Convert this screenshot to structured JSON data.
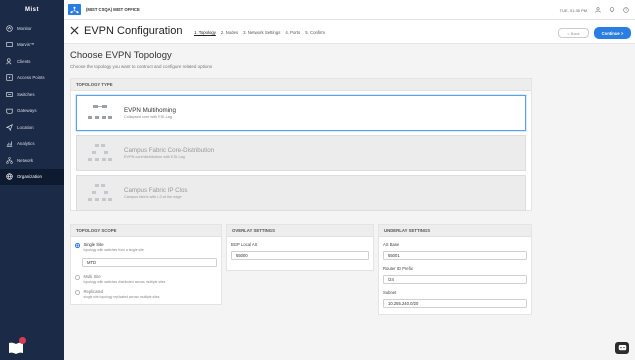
{
  "app": {
    "logo": "Mist"
  },
  "sidebar": {
    "items": [
      {
        "label": "Monitor",
        "icon": "monitor-icon"
      },
      {
        "label": "Marvis™",
        "icon": "marvis-icon"
      },
      {
        "label": "Clients",
        "icon": "clients-icon"
      },
      {
        "label": "Access Points",
        "icon": "access-points-icon"
      },
      {
        "label": "Switches",
        "icon": "switches-icon"
      },
      {
        "label": "Gateways",
        "icon": "gateways-icon"
      },
      {
        "label": "Location",
        "icon": "location-icon"
      },
      {
        "label": "Analytics",
        "icon": "analytics-icon"
      },
      {
        "label": "Network",
        "icon": "network-icon"
      },
      {
        "label": "Organization",
        "icon": "organization-icon"
      }
    ],
    "active_index": 9
  },
  "topbar": {
    "org": "(MIST CSQA) MIST OFFICE",
    "time": "TUE, 01:35 PM"
  },
  "header": {
    "title": "EVPN Configuration",
    "steps": [
      "1. Topology",
      "2. Nodes",
      "3. Network Settings",
      "4. Ports",
      "5. Confirm"
    ],
    "active_step": 0,
    "back_label": "< Back",
    "continue_label": "Continue >"
  },
  "content": {
    "title": "Choose EVPN Topology",
    "subtitle": "Choose the topology you want to contruct and configure related options"
  },
  "topology_type": {
    "heading": "TOPOLOGY TYPE",
    "options": [
      {
        "name": "EVPN Multihoming",
        "desc": "Collapsed core with ESI-Lag",
        "selected": true
      },
      {
        "name": "Campus Fabric Core-Distribution",
        "desc": "EVPN core/distribution with ESI-Lag",
        "selected": false
      },
      {
        "name": "Campus Fabric IP Clos",
        "desc": "Campus fabric with L3 at the edge",
        "selected": false
      }
    ]
  },
  "topology_scope": {
    "heading": "TOPOLOGY SCOPE",
    "options": [
      {
        "label": "Single Site",
        "desc": "topology with switches from a single site",
        "selected": true
      },
      {
        "label": "Multi Site",
        "desc": "topology with switches distributed across multiple sites",
        "selected": false
      },
      {
        "label": "Replicated",
        "desc": "single site topology replicated across multiple sites",
        "selected": false
      }
    ],
    "site_value": "MTD"
  },
  "overlay": {
    "heading": "OVERLAY SETTINGS",
    "bgp_label": "BGP Local AS",
    "bgp_value": "65000"
  },
  "underlay": {
    "heading": "UNDERLAY SETTINGS",
    "as_base_label": "AS Base",
    "as_base_value": "65001",
    "router_id_label": "Router ID Prefix",
    "router_id_value": "/24",
    "subnet_label": "Subnet",
    "subnet_value": "10.255.240.0/20"
  },
  "colors": {
    "sidebar": "#1b2a46",
    "accent": "#2a7de1",
    "badge": "#d93b54"
  }
}
